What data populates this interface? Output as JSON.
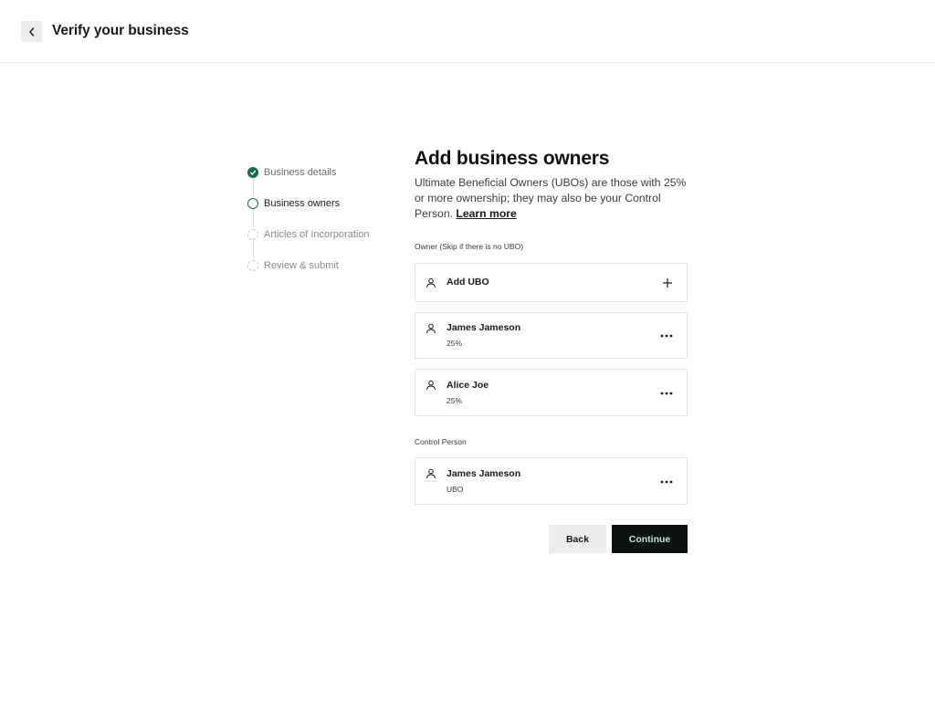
{
  "header": {
    "title": "Verify your business",
    "back_icon": "chevron-left-icon"
  },
  "stepper": {
    "steps": [
      {
        "label": "Business details",
        "state": "completed"
      },
      {
        "label": "Business owners",
        "state": "current"
      },
      {
        "label": "Articles of Incorporation",
        "state": "pending"
      },
      {
        "label": "Review & submit",
        "state": "pending"
      }
    ]
  },
  "main": {
    "title": "Add business owners",
    "description": "Ultimate Beneficial Owners (UBOs) are those with 25% or more ownership; they may also be your Control Person.",
    "learn_more": "Learn more"
  },
  "owners_section": {
    "label": "Owner (Skip if there is no UBO)",
    "add_label": "Add UBO",
    "owners": [
      {
        "name": "James Jameson",
        "share": "25%"
      },
      {
        "name": "Alice Joe",
        "share": "25%"
      }
    ]
  },
  "control_section": {
    "label": "Control Person",
    "person": {
      "name": "James Jameson",
      "role": "UBO"
    }
  },
  "actions": {
    "back_label": "Back",
    "continue_label": "Continue"
  },
  "colors": {
    "accent_green": "#176b4e",
    "continue_bg": "#0d1210",
    "continue_text": "#bfe6d8",
    "back_bg": "#ececec"
  }
}
